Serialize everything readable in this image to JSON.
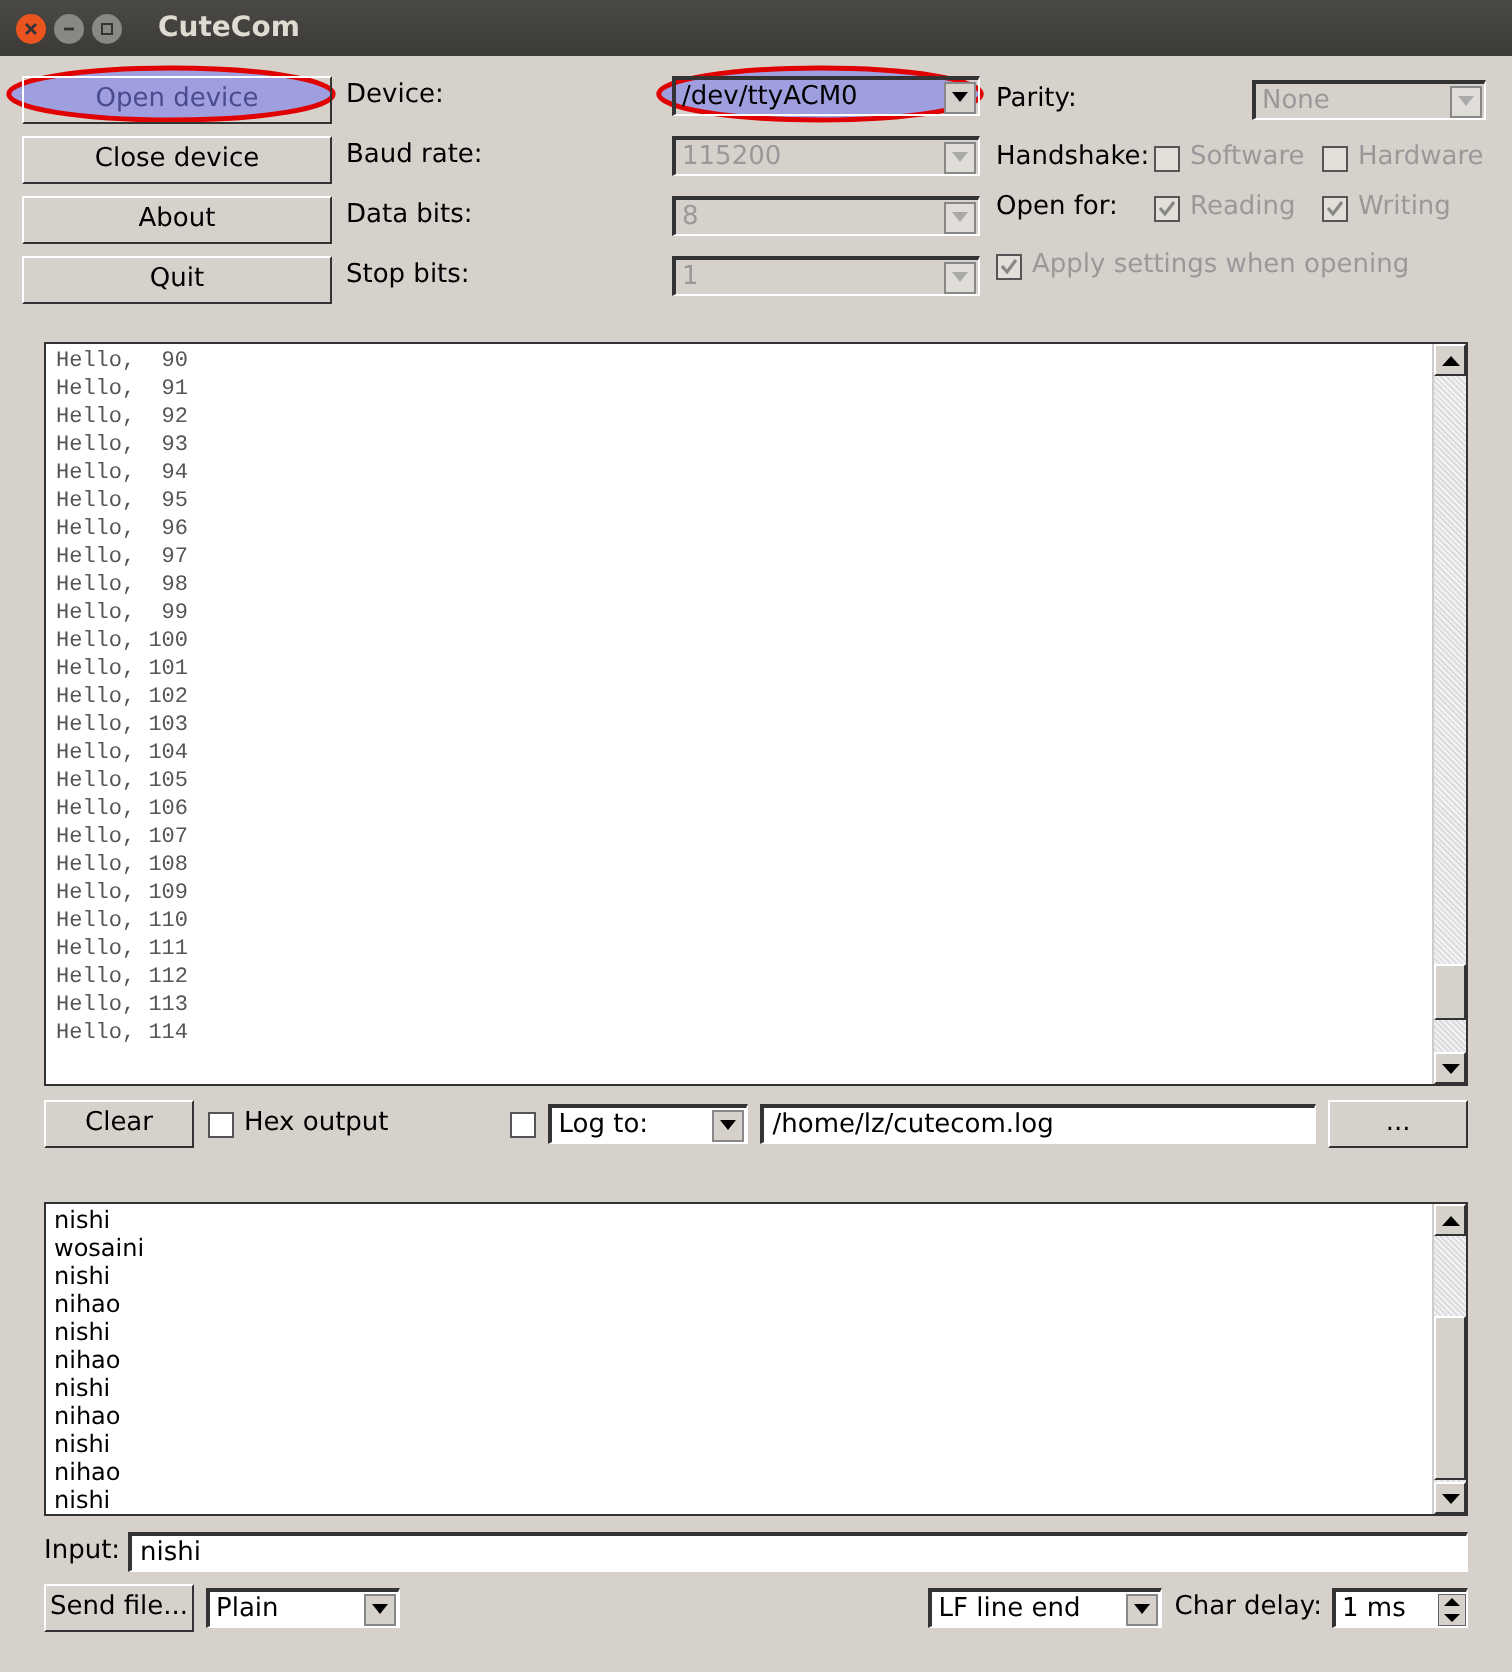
{
  "window": {
    "title": "CuteCom"
  },
  "buttons": [
    {
      "label": "Open device",
      "disabled": true,
      "highlighted": true
    },
    {
      "label": "Close device",
      "disabled": false,
      "highlighted": false
    },
    {
      "label": "About",
      "disabled": false,
      "highlighted": false
    },
    {
      "label": "Quit",
      "disabled": false,
      "highlighted": false
    }
  ],
  "settings": [
    {
      "label": "Device:",
      "value": "/dev/ttyACM0",
      "disabled": false,
      "highlighted": true
    },
    {
      "label": "Baud rate:",
      "value": "115200",
      "disabled": true,
      "highlighted": false
    },
    {
      "label": "Data bits:",
      "value": "8",
      "disabled": true,
      "highlighted": false
    },
    {
      "label": "Stop bits:",
      "value": "1",
      "disabled": true,
      "highlighted": false
    }
  ],
  "parity": {
    "label": "Parity:",
    "value": "None",
    "disabled": true
  },
  "handshake": {
    "label": "Handshake:",
    "options": [
      {
        "label": "Software",
        "checked": false,
        "disabled": true
      },
      {
        "label": "Hardware",
        "checked": false,
        "disabled": true
      }
    ]
  },
  "open_for": {
    "label": "Open for:",
    "options": [
      {
        "label": "Reading",
        "checked": true,
        "disabled": true
      },
      {
        "label": "Writing",
        "checked": true,
        "disabled": true
      }
    ]
  },
  "apply_settings": {
    "label": "Apply settings when opening",
    "checked": true,
    "disabled": true
  },
  "output": [
    "Hello,  90",
    "Hello,  91",
    "Hello,  92",
    "Hello,  93",
    "Hello,  94",
    "Hello,  95",
    "Hello,  96",
    "Hello,  97",
    "Hello,  98",
    "Hello,  99",
    "Hello, 100",
    "Hello, 101",
    "Hello, 102",
    "Hello, 103",
    "Hello, 104",
    "Hello, 105",
    "Hello, 106",
    "Hello, 107",
    "Hello, 108",
    "Hello, 109",
    "Hello, 110",
    "Hello, 111",
    "Hello, 112",
    "Hello, 113",
    "Hello, 114"
  ],
  "output_controls": {
    "clear": "Clear",
    "hex_output": {
      "label": "Hex output",
      "checked": false
    },
    "log": {
      "checked": false,
      "mode": "Log to:",
      "path": "/home/lz/cutecom.log",
      "browse": "..."
    }
  },
  "history": [
    "nishi",
    "wosaini",
    "nishi",
    "nihao",
    "nishi",
    "nihao",
    "nishi",
    "nihao",
    "nishi",
    "nihao",
    "nishi"
  ],
  "input": {
    "label": "Input:",
    "value": "nishi"
  },
  "send": {
    "send_file": "Send file...",
    "mode": "Plain",
    "line_end": "LF line end",
    "char_delay_label": "Char delay:",
    "char_delay": "1 ms"
  }
}
